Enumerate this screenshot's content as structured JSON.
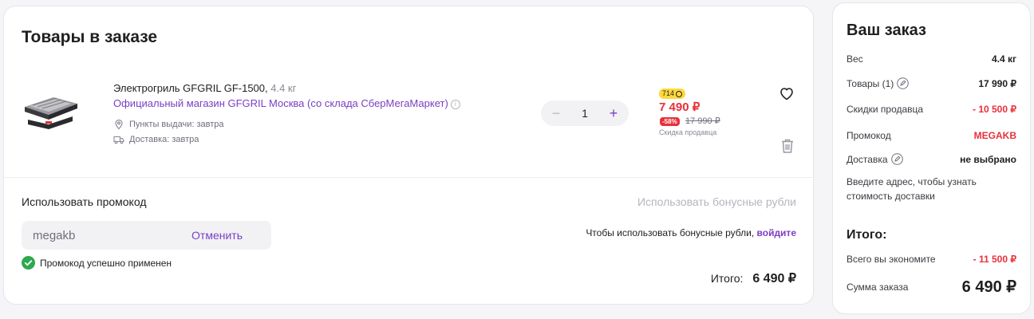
{
  "cart": {
    "title": "Товары в заказе",
    "product": {
      "name": "Электрогриль GFGRIL GF-1500,",
      "weight": "4.4 кг",
      "seller": "Официальный магазин GFGRIL Москва (со склада СберМегаМаркет)",
      "pickup": "Пункты выдачи: завтра",
      "delivery": "Доставка: завтра",
      "quantity": "1",
      "bonus": "714",
      "price": "7 490 ₽",
      "discount_badge": "-58%",
      "old_price": "17 990 ₽",
      "discount_caption": "Скидка продавца"
    },
    "promo": {
      "title": "Использовать промокод",
      "value": "megakb",
      "cancel_label": "Отменить",
      "success": "Промокод успешно применен"
    },
    "bonus": {
      "use_label": "Использовать бонусные рубли",
      "hint": "Чтобы использовать бонусные рубли,",
      "login_label": "войдите"
    },
    "total": {
      "label": "Итого:",
      "value": "6 490 ₽"
    }
  },
  "order": {
    "title": "Ваш заказ",
    "rows": [
      {
        "label": "Вес",
        "value": "4.4 кг"
      },
      {
        "label": "Товары (1)",
        "value": "17 990 ₽"
      },
      {
        "label": "Скидки продавца",
        "value": "- 10 500 ₽"
      },
      {
        "label": "Промокод",
        "value": "MEGAKB"
      },
      {
        "label": "Доставка",
        "value": "не выбрано"
      }
    ],
    "delivery_note": "Введите адрес, чтобы узнать стоимость доставки",
    "total_title": "Итого:",
    "savings_label": "Всего вы экономите",
    "savings_value": "- 11 500 ₽",
    "sum_label": "Сумма заказа",
    "sum_value": "6 490 ₽"
  },
  "colors": {
    "accent": "#7b3fc4",
    "discount": "#e8303a",
    "bonus_badge": "#ffd83d",
    "success": "#2fa84f"
  },
  "icons": [
    "product-image",
    "info-icon",
    "pin-icon",
    "truck-icon",
    "heart-icon",
    "trash-icon",
    "check-icon",
    "pencil-icon"
  ]
}
